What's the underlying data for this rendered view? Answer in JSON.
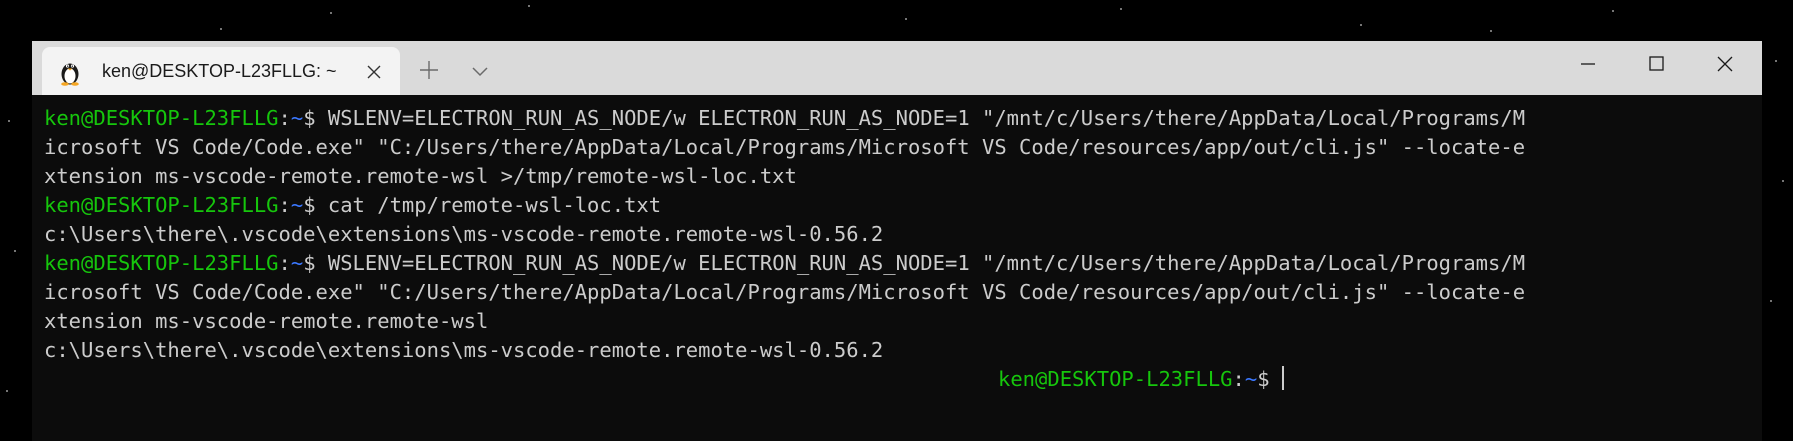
{
  "window": {
    "tab_title": "ken@DESKTOP-L23FLLG: ~",
    "tab_icon": "linux-penguin-icon"
  },
  "prompt": {
    "user_host": "ken@DESKTOP-L23FLLG",
    "colon": ":",
    "path": "~",
    "symbol": "$ "
  },
  "terminal": {
    "lines": [
      {
        "type": "prompt",
        "text": "WSLENV=ELECTRON_RUN_AS_NODE/w ELECTRON_RUN_AS_NODE=1 \"/mnt/c/Users/there/AppData/Local/Programs/M"
      },
      {
        "type": "output",
        "text": "icrosoft VS Code/Code.exe\" \"C:/Users/there/AppData/Local/Programs/Microsoft VS Code/resources/app/out/cli.js\" --locate-e"
      },
      {
        "type": "output",
        "text": "xtension ms-vscode-remote.remote-wsl >/tmp/remote-wsl-loc.txt"
      },
      {
        "type": "prompt",
        "text": "cat /tmp/remote-wsl-loc.txt"
      },
      {
        "type": "output",
        "text": "c:\\Users\\there\\.vscode\\extensions\\ms-vscode-remote.remote-wsl-0.56.2"
      },
      {
        "type": "prompt",
        "text": "WSLENV=ELECTRON_RUN_AS_NODE/w ELECTRON_RUN_AS_NODE=1 \"/mnt/c/Users/there/AppData/Local/Programs/M"
      },
      {
        "type": "output",
        "text": "icrosoft VS Code/Code.exe\" \"C:/Users/there/AppData/Local/Programs/Microsoft VS Code/resources/app/out/cli.js\" --locate-e"
      },
      {
        "type": "output",
        "text": "xtension ms-vscode-remote.remote-wsl"
      },
      {
        "type": "output",
        "text": "c:\\Users\\there\\.vscode\\extensions\\ms-vscode-remote.remote-wsl-0.56.2"
      }
    ]
  },
  "colors": {
    "user_host": "#16c60c",
    "path": "#3b78ff",
    "text": "#cccccc",
    "background": "#0c0c0c",
    "titlebar": "#dadada",
    "tab": "#f3f3f3"
  }
}
